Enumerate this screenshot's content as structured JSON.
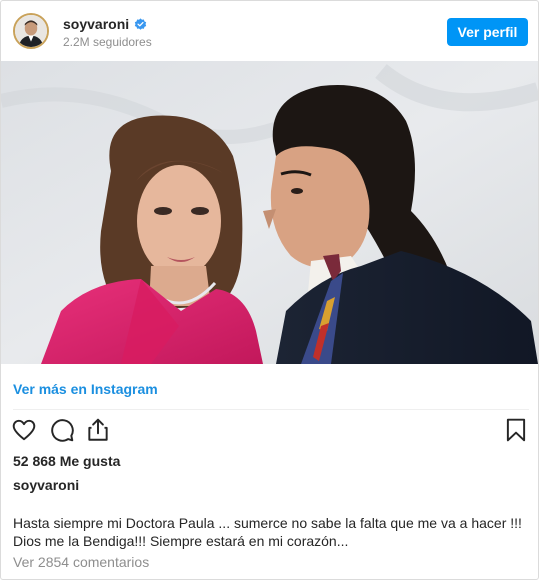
{
  "header": {
    "username": "soyvaroni",
    "followers": "2.2M seguidores",
    "profile_button": "Ver perfil",
    "avatar_icon": "profile-avatar",
    "verified_icon": "verified-badge-icon"
  },
  "post": {
    "image_alt": "Photo of a woman in a pink jacket and a man in a dark suit",
    "more_link": "Ver más en Instagram",
    "likes": "52 868 Me gusta",
    "caption_user": "soyvaroni",
    "caption_line1": "Hasta siempre mi Doctora Paula ... sumerce no sabe la falta que me va a hacer !!!",
    "caption_line2": "Dios me la Bendiga!!! Siempre estará en mi corazón...",
    "comments": "Ver 2854 comentarios"
  },
  "icons": {
    "like": "heart-icon",
    "comment": "comment-icon",
    "share": "share-icon",
    "save": "bookmark-icon"
  },
  "colors": {
    "accent": "#0095f6",
    "link": "#1b8fe0",
    "muted": "#8e8e8e",
    "border": "#dbdbdb"
  }
}
